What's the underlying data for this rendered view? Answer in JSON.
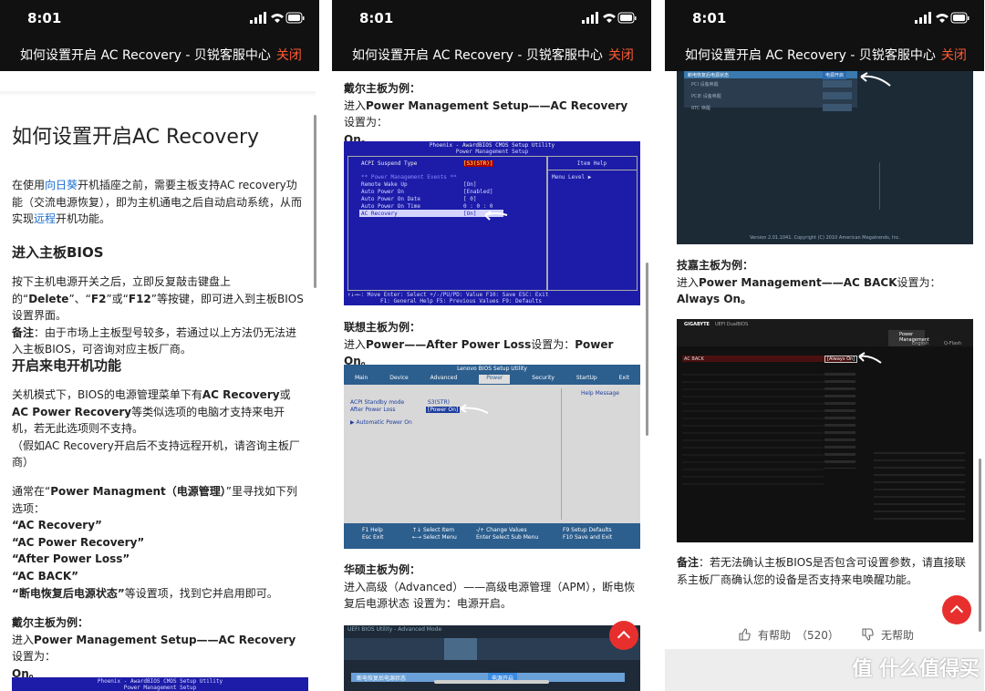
{
  "status": {
    "time": "8:01"
  },
  "header": {
    "title": "如何设置开启 AC Recovery - 贝锐客服中心",
    "close": "关闭"
  },
  "p1": {
    "h1": "如何设置开启AC Recovery",
    "intro1": "在使用",
    "intro_link1": "向日葵",
    "intro2": "开机插座之前，需要主板支持AC recovery功能（交流电源恢复），即为主机通电之后自动启动系统，从而实现",
    "intro_link2": "远程",
    "intro3": "开机功能。",
    "h2a": "进入主板BIOS",
    "s1a": "按下主机电源开关之后，立即反复敲击键盘上的“",
    "s1b": "Delete",
    "s1c": "”、“",
    "s1d": "F2",
    "s1e": "”或“",
    "s1f": "F12",
    "s1g": "”等按键，即可进入到主板BIOS设置界面。",
    "s2a": "备注",
    "s2b": "：由于市场上主板型号较多，若通过以上方法仍无法进入主板BIOS，可咨询对应主板厂商。",
    "h2b": "开启来电开机功能",
    "s3a": "关机模式下，BIOS的电源管理菜单下有",
    "s3b": "AC Recovery",
    "s3c": "或",
    "s3d": "AC Power Recovery",
    "s3e": "等类似选项的电脑才支持来电开机，若无此选项则不支持。",
    "s4": "（假如AC Recovery开启后不支持远程开机，请咨询主板厂商）",
    "s5a": "通常在“",
    "s5b": "Power Managment（电源管理）",
    "s5c": "”里寻找如下列选项：",
    "opt1": "“AC Recovery”",
    "opt2": "“AC Power Recovery”",
    "opt3": "“After Power Loss”",
    "opt4": "“AC BACK”",
    "opt5a": "“断电恢复后电源状态”",
    "opt5b": "等设置项，找到它并启用即可。",
    "dell_h": "戴尔主板为例：",
    "dell1": "进入",
    "dell2": "Power Management Setup——AC Recovery",
    "dell3": "设置为：",
    "dell4": "On。",
    "bios_title": "Phoenix - AwardBIOS CMOS Setup Utility",
    "bios_sub": "Power Management Setup"
  },
  "p2": {
    "dell_h": "戴尔主板为例：",
    "dell1": "进入",
    "dell2": "Power Management Setup——AC Recovery",
    "dell3": "设置为：",
    "dell4": "On。",
    "bios": {
      "title": "Phoenix - AwardBIOS CMOS Setup Utility",
      "sub": "Power Management Setup",
      "row1_l": "ACPI Suspend Type",
      "row1_v": "[S3(STR)]",
      "section": "** Power Management Events **",
      "r2_l": "Remote Wake Up",
      "r2_v": "[On]",
      "r3_l": "Auto Power On",
      "r3_v": "[Enabled]",
      "r4_l": "Auto Power On Date",
      "r4_v": "[ 0]",
      "r5_l": "Auto Power On Time",
      "r5_v": "0 : 0 : 0",
      "r6_l": "AC Recovery",
      "r6_v": "[On]",
      "help_h": "Item Help",
      "help_l": "Menu Level   ▶",
      "foot1": "↑↓→←: Move   Enter: Select   +/-/PU/PD: Value   F10: Save   ESC: Exit",
      "foot2": "F1: General Help   F5: Previous Values   F9: Defaults"
    },
    "lenovo_h": "联想主板为例：",
    "len1": "进入",
    "len2": "Power——After Power Loss",
    "len3": "设置为：",
    "len4": "Power On。",
    "lenovo": {
      "title": "Lenovo BIOS Setup Utility",
      "tabs": [
        "Main",
        "Device",
        "Advanced",
        "Power",
        "Security",
        "StartUp",
        "Exit"
      ],
      "r1_l": "ACPI Standby mode",
      "r1_v": "S3(STR)",
      "r2_l": "After Power Loss",
      "r2_v": "[Power On]",
      "r3_l": "▶ Automatic Power On",
      "help": "Help Message",
      "f1": "F1   Help",
      "f2": "Esc   Exit",
      "f3": "↑↓   Select Item",
      "f4": "←→   Select Menu",
      "f5": "-/+   Change Values",
      "f6": "Enter   Select Sub Menu",
      "f7": "F9   Setup Defaults",
      "f8": "F10   Save and Exit"
    },
    "asus_h": "华硕主板为例：",
    "asus1": "进入高级（Advanced）——高级电源管理（APM），断电恢复后电源状态 设置为：电源开启。",
    "asus": {
      "title": "UEFI BIOS Utility - Advanced Mode",
      "row": "断电恢复后电源状态",
      "val": "电源开启"
    }
  },
  "p3": {
    "ami": {
      "rows": [
        "断电恢复后电源状态",
        "PCI 设备唤醒",
        "PCIE 设备唤醒",
        "RTC 唤醒"
      ],
      "val": "电源开启",
      "copyright": "Version 2.01.1041. Copyright (C) 2010 American Megatrends, Inc."
    },
    "giga_h": "技嘉主板为例：",
    "giga1": "进入",
    "giga2": "Power Management——AC BACK",
    "giga3": "设置为：",
    "giga4": "Always On。",
    "giga": {
      "brand": "GIGABYTE",
      "util": "UEFI DualBIOS",
      "row": "AC BACK",
      "val": "[Always On]",
      "tab": "Power Management",
      "lang": "English",
      "qflash": "Q-Flash"
    },
    "note_a": "备注",
    "note_b": "：若无法确认主板BIOS是否包含可设置参数，请直接联系主板厂商确认您的设备是否支持来电唤醒功能。",
    "helpful": "有帮助",
    "helpful_count": "（520）",
    "unhelpful": "无帮助",
    "watermark": "值 什么值得买"
  }
}
